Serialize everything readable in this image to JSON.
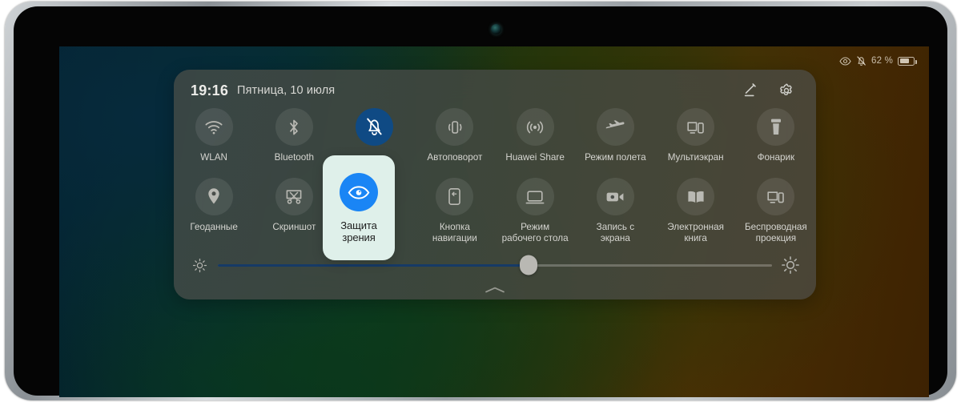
{
  "device": {
    "type": "tablet",
    "camera": "front-camera",
    "side_button": "power-button"
  },
  "status_bar": {
    "eye_comfort_icon": "eye-icon",
    "silent_icon": "bell-muted-icon",
    "battery_percent": "62 %",
    "battery_level": 62,
    "battery_icon": "battery-icon"
  },
  "quick_settings": {
    "time": "19:16",
    "date": "Пятница, 10 июля",
    "edit_icon": "pencil-icon",
    "settings_icon": "gear-icon",
    "handle_icon": "chevron-up-icon",
    "rows": [
      [
        {
          "label": "WLAN",
          "icon": "wifi-icon",
          "active": false
        },
        {
          "label": "Bluetooth",
          "icon": "bluetooth-icon",
          "active": false
        },
        {
          "label": "",
          "icon": "bell-muted-icon",
          "active": true
        },
        {
          "label": "Автоповорот",
          "icon": "auto-rotate-icon",
          "active": false
        },
        {
          "label": "Huawei Share",
          "icon": "huawei-share-icon",
          "active": false
        },
        {
          "label": "Режим полета",
          "icon": "airplane-icon",
          "active": false
        },
        {
          "label": "Мультиэкран",
          "icon": "multiscreen-icon",
          "active": false
        },
        {
          "label": "Фонарик",
          "icon": "flashlight-icon",
          "active": false
        }
      ],
      [
        {
          "label": "Геоданные",
          "icon": "location-pin-icon",
          "active": false
        },
        {
          "label": "Скриншот",
          "icon": "screenshot-scissors-icon",
          "active": false
        },
        {
          "label": "",
          "icon": "eye-comfort-icon",
          "active": true
        },
        {
          "label": "Кнопка\nнавигации",
          "icon": "nav-button-icon",
          "active": false
        },
        {
          "label": "Режим\nрабочего стола",
          "icon": "desktop-mode-icon",
          "active": false
        },
        {
          "label": "Запись с\nэкрана",
          "icon": "screen-record-icon",
          "active": false
        },
        {
          "label": "Электронная\nкнига",
          "icon": "ebook-icon",
          "active": false
        },
        {
          "label": "Беспроводная\nпроекция",
          "icon": "wireless-projection-icon",
          "active": false
        }
      ]
    ],
    "brightness": {
      "low_icon": "brightness-low-icon",
      "high_icon": "brightness-high-icon",
      "value_percent": 56
    }
  },
  "highlight_card": {
    "label": "Защита зрения",
    "icon": "eye-comfort-icon",
    "icon_color": "#1a85f5",
    "card_color": "#dff0ea"
  },
  "colors": {
    "panel": "#464a46",
    "active_tile": "#0f4a84",
    "slider_fill": "#163a66",
    "accent_blue": "#1a85f5"
  }
}
